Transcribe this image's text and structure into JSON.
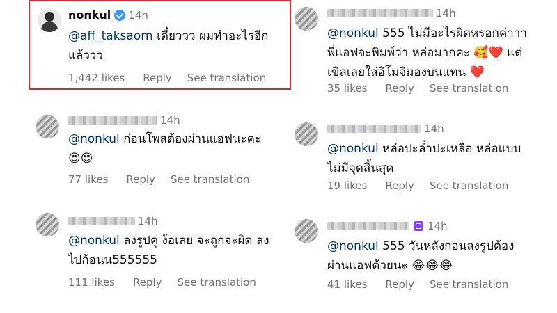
{
  "comments_left": [
    {
      "username": "nonkul",
      "verified": true,
      "time": "14h",
      "mention": "@aff_taksaorn",
      "line1": " เดี๋ยววว ผมทำอะไรอีก",
      "line2": "แล้ววว",
      "likes": "1,442 likes",
      "reply": "Reply",
      "translate": "See translation"
    },
    {
      "time": "14h",
      "mention": "@nonkul",
      "line1": " ก่อนโพสต้องผ่านแอฟนะคะ",
      "line2": "😍😍",
      "likes": "77 likes",
      "reply": "Reply",
      "translate": "See translation"
    },
    {
      "time": "14h",
      "mention": "@nonkul",
      "line1": " ลงรูปคู่ ง้อเลย จะถูกจะผิด ลง",
      "line2": "ไปก้อนน555555",
      "likes": "111 likes",
      "reply": "Reply",
      "translate": "See translation"
    }
  ],
  "comments_right": [
    {
      "time": "14h",
      "mention": "@nonkul",
      "line1": " 555 ไม่มีอะไรผิดหรอกค่าาา",
      "line2": "พี่แอฟจะพิมพ์ว่า หล่อมากคะ 🥰❤️ แต่",
      "line3": "เขิลเลยใส่อิโมจิมองบนแทน ❤️",
      "likes": "35 likes",
      "reply": "Reply",
      "translate": "See translation"
    },
    {
      "time": "14h",
      "mention": "@nonkul",
      "line1": " หล่อปะล่ำปะเหลือ หล่อแบบ",
      "line2": "ไม่มีจุดสิ้นสุด",
      "likes": "19 likes",
      "reply": "Reply",
      "translate": "See translation"
    },
    {
      "time": "14h",
      "mention": "@nonkul",
      "line1": " 555 วันหลังก่อนลงรูปต้อง",
      "line2": "ผ่านแอฟด้วยนะ 😂😂😂",
      "likes": "41 likes",
      "reply": "Reply",
      "translate": "See translation"
    }
  ],
  "icons": {
    "verified": "verified-badge-icon",
    "subscriber": "subscriber-badge-icon"
  },
  "colors": {
    "mention": "#00376b",
    "meta": "#737373",
    "highlight": "#e0282e",
    "verified": "#3897f0"
  }
}
